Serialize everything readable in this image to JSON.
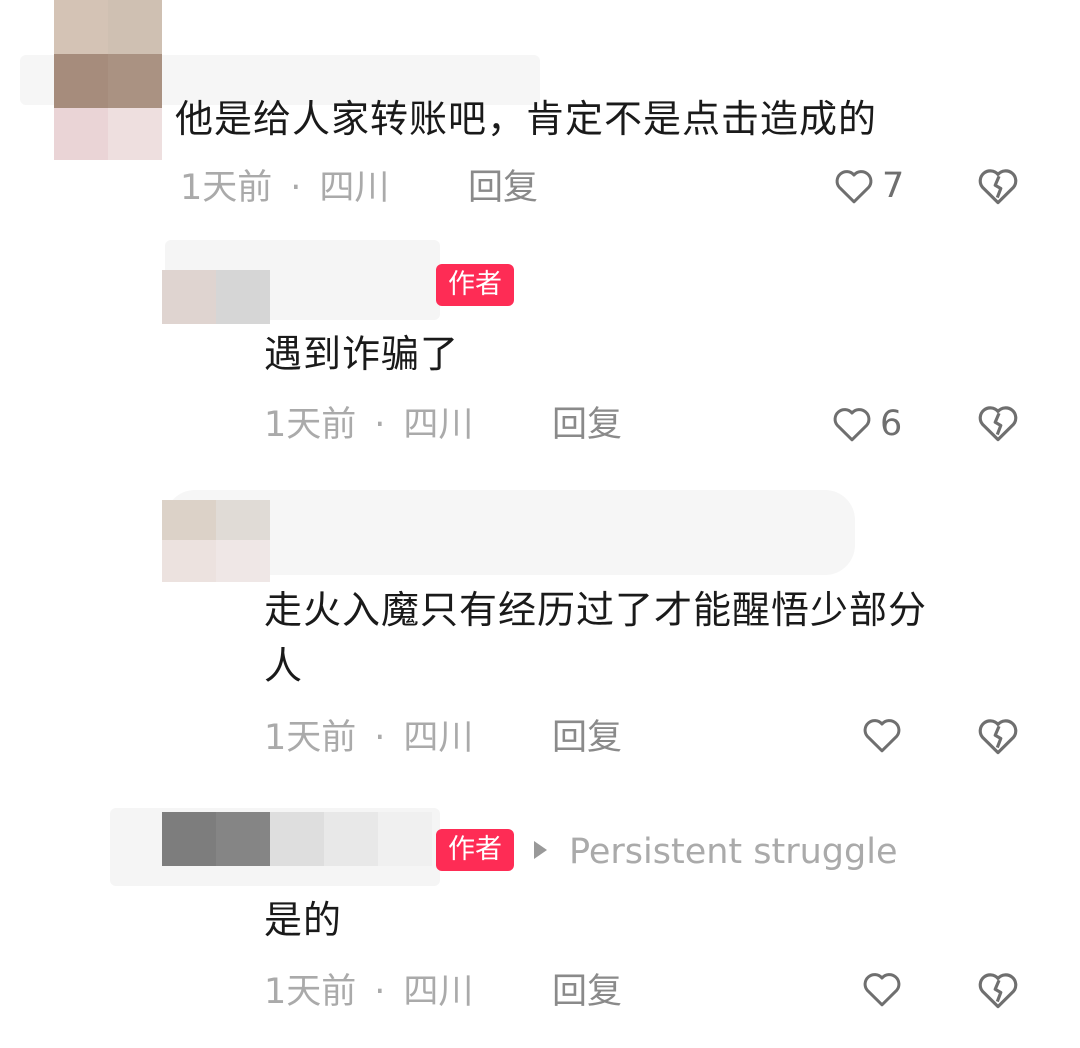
{
  "comments": [
    {
      "text": "他是给人家转账吧，肯定不是点击造成的",
      "time": "1天前",
      "location": "四川",
      "reply_label": "回复",
      "likes": "7"
    },
    {
      "author_badge": "作者",
      "text": "遇到诈骗了",
      "time": "1天前",
      "location": "四川",
      "reply_label": "回复",
      "likes": "6"
    },
    {
      "text_line1": "走火入魔只有经历过了才能醒悟少部分",
      "text_line2": "人",
      "time": "1天前",
      "location": "四川",
      "reply_label": "回复",
      "likes": ""
    },
    {
      "author_badge": "作者",
      "reply_to": "Persistent struggle",
      "text": "是的",
      "time": "1天前",
      "location": "四川",
      "reply_label": "回复",
      "likes": ""
    }
  ],
  "separator": "·",
  "icons": {
    "like": "heart-outline-icon",
    "dislike": "broken-heart-icon"
  },
  "colors": {
    "author_badge": "#fe2c55",
    "meta_text": "#aaaaaa"
  }
}
